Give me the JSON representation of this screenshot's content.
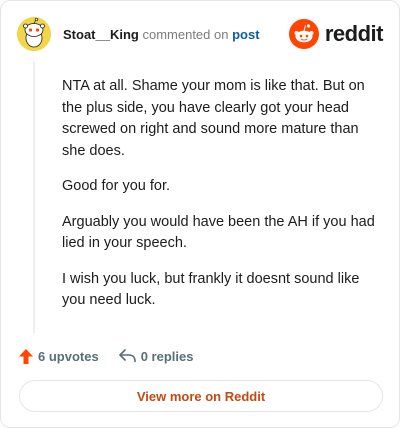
{
  "comment": {
    "username": "Stoat__King",
    "commented_text": "commented on",
    "post_link": "post",
    "paragraphs": [
      "NTA at all. Shame your mom is like that. But on the plus side, you have clearly got your head screwed on right and sound more mature than she does.",
      "Good for you for.",
      "Arguably you would have been the AH if you had lied in your speech.",
      "I wish you luck, but frankly it doesnt sound like you need luck."
    ]
  },
  "brand": {
    "logo_text": "reddit",
    "color": "#ff4500"
  },
  "actions": {
    "upvotes": "6 upvotes",
    "replies": "0 replies",
    "upvote_icon": "upvote-arrow-icon",
    "reply_icon": "reply-arrow-icon"
  },
  "footer": {
    "view_more": "View more on Reddit",
    "accent": "#c44a14"
  }
}
